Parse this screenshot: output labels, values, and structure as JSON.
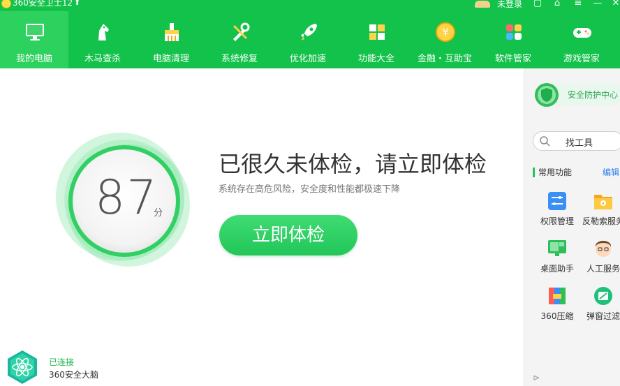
{
  "window": {
    "title": "360安全卫士12",
    "login": "未登录"
  },
  "nav": {
    "items": [
      {
        "label": "我的电脑",
        "icon": "computer-icon"
      },
      {
        "label": "木马查杀",
        "icon": "horse-icon"
      },
      {
        "label": "电脑清理",
        "icon": "broom-icon"
      },
      {
        "label": "系统修复",
        "icon": "tools-icon"
      },
      {
        "label": "优化加速",
        "icon": "rocket-icon"
      },
      {
        "label": "功能大全",
        "icon": "grid-icon"
      },
      {
        "label": "金融・互助宝",
        "icon": "yuan-coin-icon"
      },
      {
        "label": "软件管家",
        "icon": "software-icon"
      },
      {
        "label": "游戏管家",
        "icon": "gamepad-icon"
      }
    ],
    "active_index": 0
  },
  "main": {
    "score": "87",
    "score_unit": "分",
    "headline": "已很久未体检，请立即体检",
    "subline": "系统存在高危风险，安全度和性能都极速下降",
    "cta_label": "立即体检"
  },
  "brain": {
    "status": "已连接",
    "name": "360安全大脑"
  },
  "sidebar": {
    "shield_label": "安全防护中心",
    "search_placeholder": "找工具",
    "common_title": "常用功能",
    "edit_label": "编辑",
    "tools": [
      {
        "label": "权限管理",
        "icon": "permission-icon"
      },
      {
        "label": "反勒索服务",
        "icon": "anti-ransom-icon"
      },
      {
        "label": "桌面助手",
        "icon": "desktop-helper-icon"
      },
      {
        "label": "人工服务",
        "icon": "support-agent-icon"
      },
      {
        "label": "360压缩",
        "icon": "zip-icon"
      },
      {
        "label": "弹窗过滤",
        "icon": "popup-filter-icon"
      }
    ]
  },
  "colors": {
    "brand_green": "#12c24a",
    "active_nav": "#2dd25e",
    "link_blue": "#2d7ef0"
  }
}
